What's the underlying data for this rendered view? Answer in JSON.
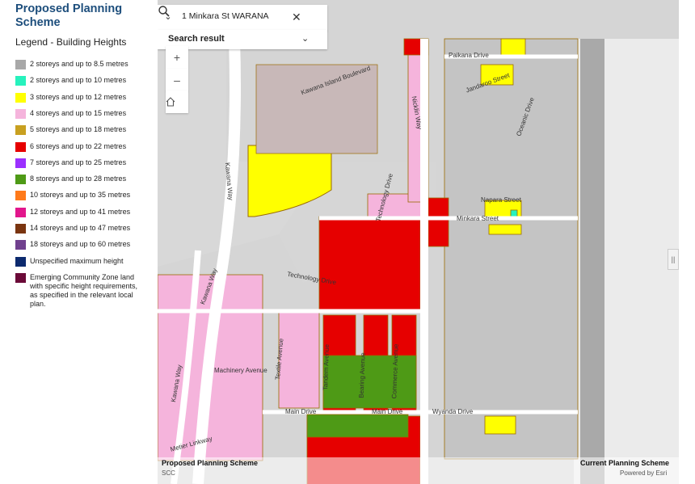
{
  "panel": {
    "title": "Proposed Planning Scheme",
    "legend_title": "Legend - Building Heights",
    "legend": [
      {
        "label": "2 storeys and up to 8.5 metres",
        "color": "#a8a8a8"
      },
      {
        "label": "2 storeys and up to 10 metres",
        "color": "#27f2bd"
      },
      {
        "label": "3 storeys and up to 12 metres",
        "color": "#ffff00"
      },
      {
        "label": "4 storeys and up to 15 metres",
        "color": "#f5b4dc"
      },
      {
        "label": "5 storeys and up to 18 metres",
        "color": "#c8a020"
      },
      {
        "label": "6 storeys and up to 22 metres",
        "color": "#e60000"
      },
      {
        "label": "7 storeys and up to 25 metres",
        "color": "#9b30ff"
      },
      {
        "label": "8 storeys and up to 28 metres",
        "color": "#4e9a16"
      },
      {
        "label": "10 storeys and up to 35 metres",
        "color": "#ff7a1a"
      },
      {
        "label": "12 storeys and up to 41 metres",
        "color": "#e2168c"
      },
      {
        "label": "14 storeys and up to 47 metres",
        "color": "#7a3510"
      },
      {
        "label": "18 storeys and up to 60 metres",
        "color": "#70408e"
      },
      {
        "label": "Unspecified maximum height",
        "color": "#0c2a6e"
      },
      {
        "label": "Emerging Community Zone land with specific height requirements, as specified in the relevant local plan.",
        "color": "#6b0a38"
      }
    ]
  },
  "search": {
    "value": "1 Minkara St WARANA",
    "result_label": "Search result",
    "icons": [
      "chevron-down-icon",
      "close-icon",
      "search-icon"
    ]
  },
  "map": {
    "streets": {
      "paikana": "Paikana Drive",
      "kawana_island": "Kawana Island Boulevard",
      "nicklin": "Nicklin Way",
      "kawana_way_top": "Kawana Way",
      "kawana_way_mid": "Kawana Way",
      "kawana_way_bot": "Kawana Way",
      "technology_1": "Technology Drive",
      "technology_2": "Technology Drive",
      "minkara": "Minkara Street",
      "napara": "Napara Street",
      "machinery": "Machinery Avenue",
      "textile": "Textile Avenue",
      "tandem": "Tandem Avenue",
      "bearing": "Bearing Avenue",
      "commerce": "Commerce Avenue",
      "main_1": "Main Drive",
      "main_2": "Main Drive",
      "wyanda": "Wyanda Drive",
      "metier": "Metier Linkway",
      "oceanic": "Oceanic Drive",
      "jandaroo": "Jandaroo Street"
    },
    "layer_left": "Proposed Planning Scheme",
    "layer_right": "Current Planning Scheme",
    "attribution_left": "SCC",
    "attribution_right": "Powered by Esri",
    "colors": {
      "background": "#d5d5d5",
      "beach": "#ebebeb",
      "ocean": "#a9a9a9",
      "boundary": "#9a6a00"
    }
  }
}
